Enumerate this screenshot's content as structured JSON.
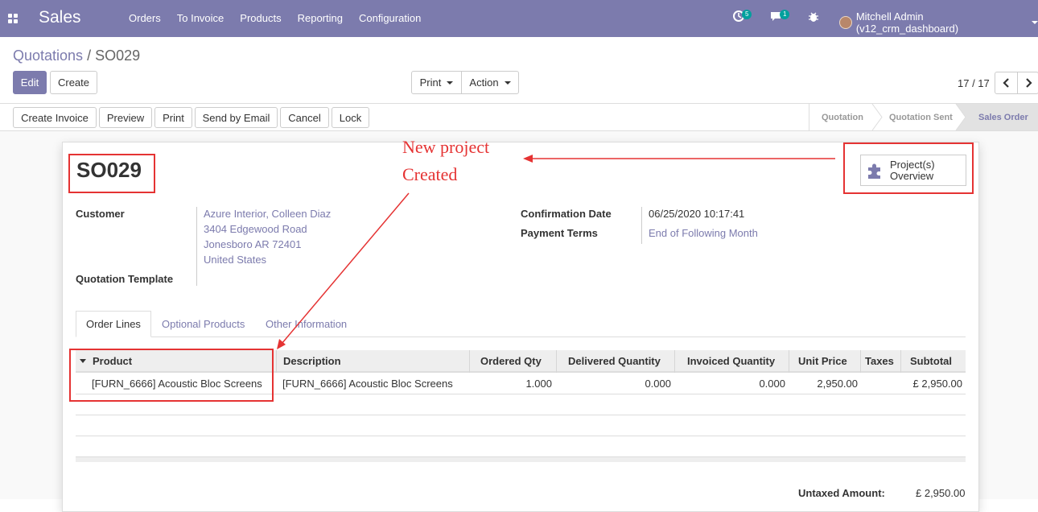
{
  "navbar": {
    "brand": "Sales",
    "menu": [
      "Orders",
      "To Invoice",
      "Products",
      "Reporting",
      "Configuration"
    ],
    "activity_count": "5",
    "message_count": "1",
    "user": "Mitchell Admin (v12_crm_dashboard)"
  },
  "breadcrumb": {
    "parent": "Quotations",
    "separator": "/",
    "current": "SO029"
  },
  "controls": {
    "edit": "Edit",
    "create": "Create",
    "print": "Print",
    "action": "Action",
    "pager": "17 / 17"
  },
  "statusbar_buttons": [
    "Create Invoice",
    "Preview",
    "Print",
    "Send by Email",
    "Cancel",
    "Lock"
  ],
  "stages": [
    "Quotation",
    "Quotation Sent",
    "Sales Order"
  ],
  "form": {
    "name": "SO029",
    "customer_label": "Customer",
    "customer_lines": [
      "Azure Interior, Colleen Diaz",
      "3404 Edgewood Road",
      "Jonesboro AR 72401",
      "United States"
    ],
    "template_label": "Quotation Template",
    "confirmation_label": "Confirmation Date",
    "confirmation_value": "06/25/2020 10:17:41",
    "payment_label": "Payment Terms",
    "payment_value": "End of Following Month",
    "smart_button": [
      "Project(s)",
      "Overview"
    ]
  },
  "tabs": [
    "Order Lines",
    "Optional Products",
    "Other Information"
  ],
  "table": {
    "headers": [
      "Product",
      "Description",
      "Ordered Qty",
      "Delivered Quantity",
      "Invoiced Quantity",
      "Unit Price",
      "Taxes",
      "Subtotal"
    ],
    "row": [
      "[FURN_6666] Acoustic Bloc Screens",
      "[FURN_6666] Acoustic Bloc Screens",
      "1.000",
      "0.000",
      "0.000",
      "2,950.00",
      "",
      "£ 2,950.00"
    ]
  },
  "totals": {
    "untaxed_label": "Untaxed Amount:",
    "untaxed_value": "£ 2,950.00"
  },
  "annotation": {
    "line1": "New project",
    "line2": "Created",
    "color": "#e53333"
  },
  "colors": {
    "brand": "#7c7bad",
    "badge": "#00a09d"
  }
}
